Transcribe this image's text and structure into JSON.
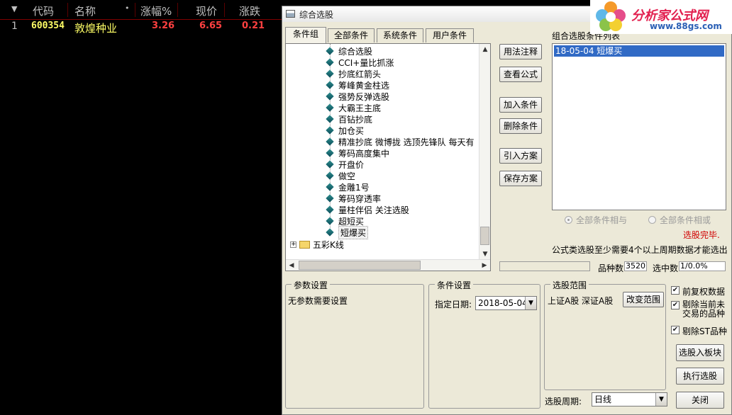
{
  "stock_table": {
    "headers": [
      "代码",
      "名称",
      "•",
      "涨幅%",
      "现价",
      "涨跌"
    ],
    "row": {
      "index": "1",
      "code": "600354",
      "name": "敦煌种业",
      "change_pct": "3.26",
      "price": "6.65",
      "change": "0.21"
    }
  },
  "dialog": {
    "title": "综合选股",
    "tabs": [
      "条件组",
      "全部条件",
      "系统条件",
      "用户条件"
    ],
    "tree_items": [
      "综合选股",
      "CCI+量比抓涨",
      "抄底红箭头",
      "筹峰黄金柱选",
      "强势反弹选股",
      "大霸王主底",
      "百钻抄底",
      "加仓买",
      "精准抄底 微博拢 选顶先锋队 每天有",
      "筹码高度集中",
      "开盘价",
      "做空",
      "金雕1号",
      "筹码穿透率",
      "量柱伴侣 关注选股",
      "超短买",
      "短爆买"
    ],
    "tree_folder": "五彩K线",
    "buttons": {
      "usage": "用法注释",
      "view_formula": "查看公式",
      "add_condition": "加入条件",
      "delete_condition": "删除条件",
      "import_plan": "引入方案",
      "save_plan": "保存方案",
      "change_range": "改变范围",
      "select_into_block": "选股入板块",
      "execute": "执行选股",
      "close": "关闭"
    },
    "result_label": "组合选股条件列表",
    "result_items": [
      "18-05-04 短爆买"
    ],
    "radio_and": "全部条件相与",
    "radio_or": "全部条件相或",
    "status": "选股完毕.",
    "note": "公式类选股至少需要4个以上周期数据才能选出",
    "variety_label": "品种数",
    "variety_value": "3520",
    "selected_label": "选中数",
    "selected_value": "1/0.0%",
    "params_group": "参数设置",
    "params_text": "无参数需要设置",
    "cond_group": "条件设置",
    "date_label": "指定日期:",
    "date_value": "2018-05-04",
    "range_group": "选股范围",
    "range_text": "上证A股 深证A股",
    "chk_fq": "前复权数据",
    "chk_exclude_untraded": "剔除当前未交易的品种",
    "chk_exclude_st": "剔除ST品种",
    "period_label": "选股周期:",
    "period_value": "日线"
  },
  "logo": {
    "title": "分析家公式网",
    "url": "www.88gs.com"
  },
  "colors": {
    "header_text": "#c0c0c0",
    "code_yellow": "#ffff66",
    "up_red": "#ff4040",
    "selection_blue": "#316ac5",
    "status_red": "#d00000"
  }
}
